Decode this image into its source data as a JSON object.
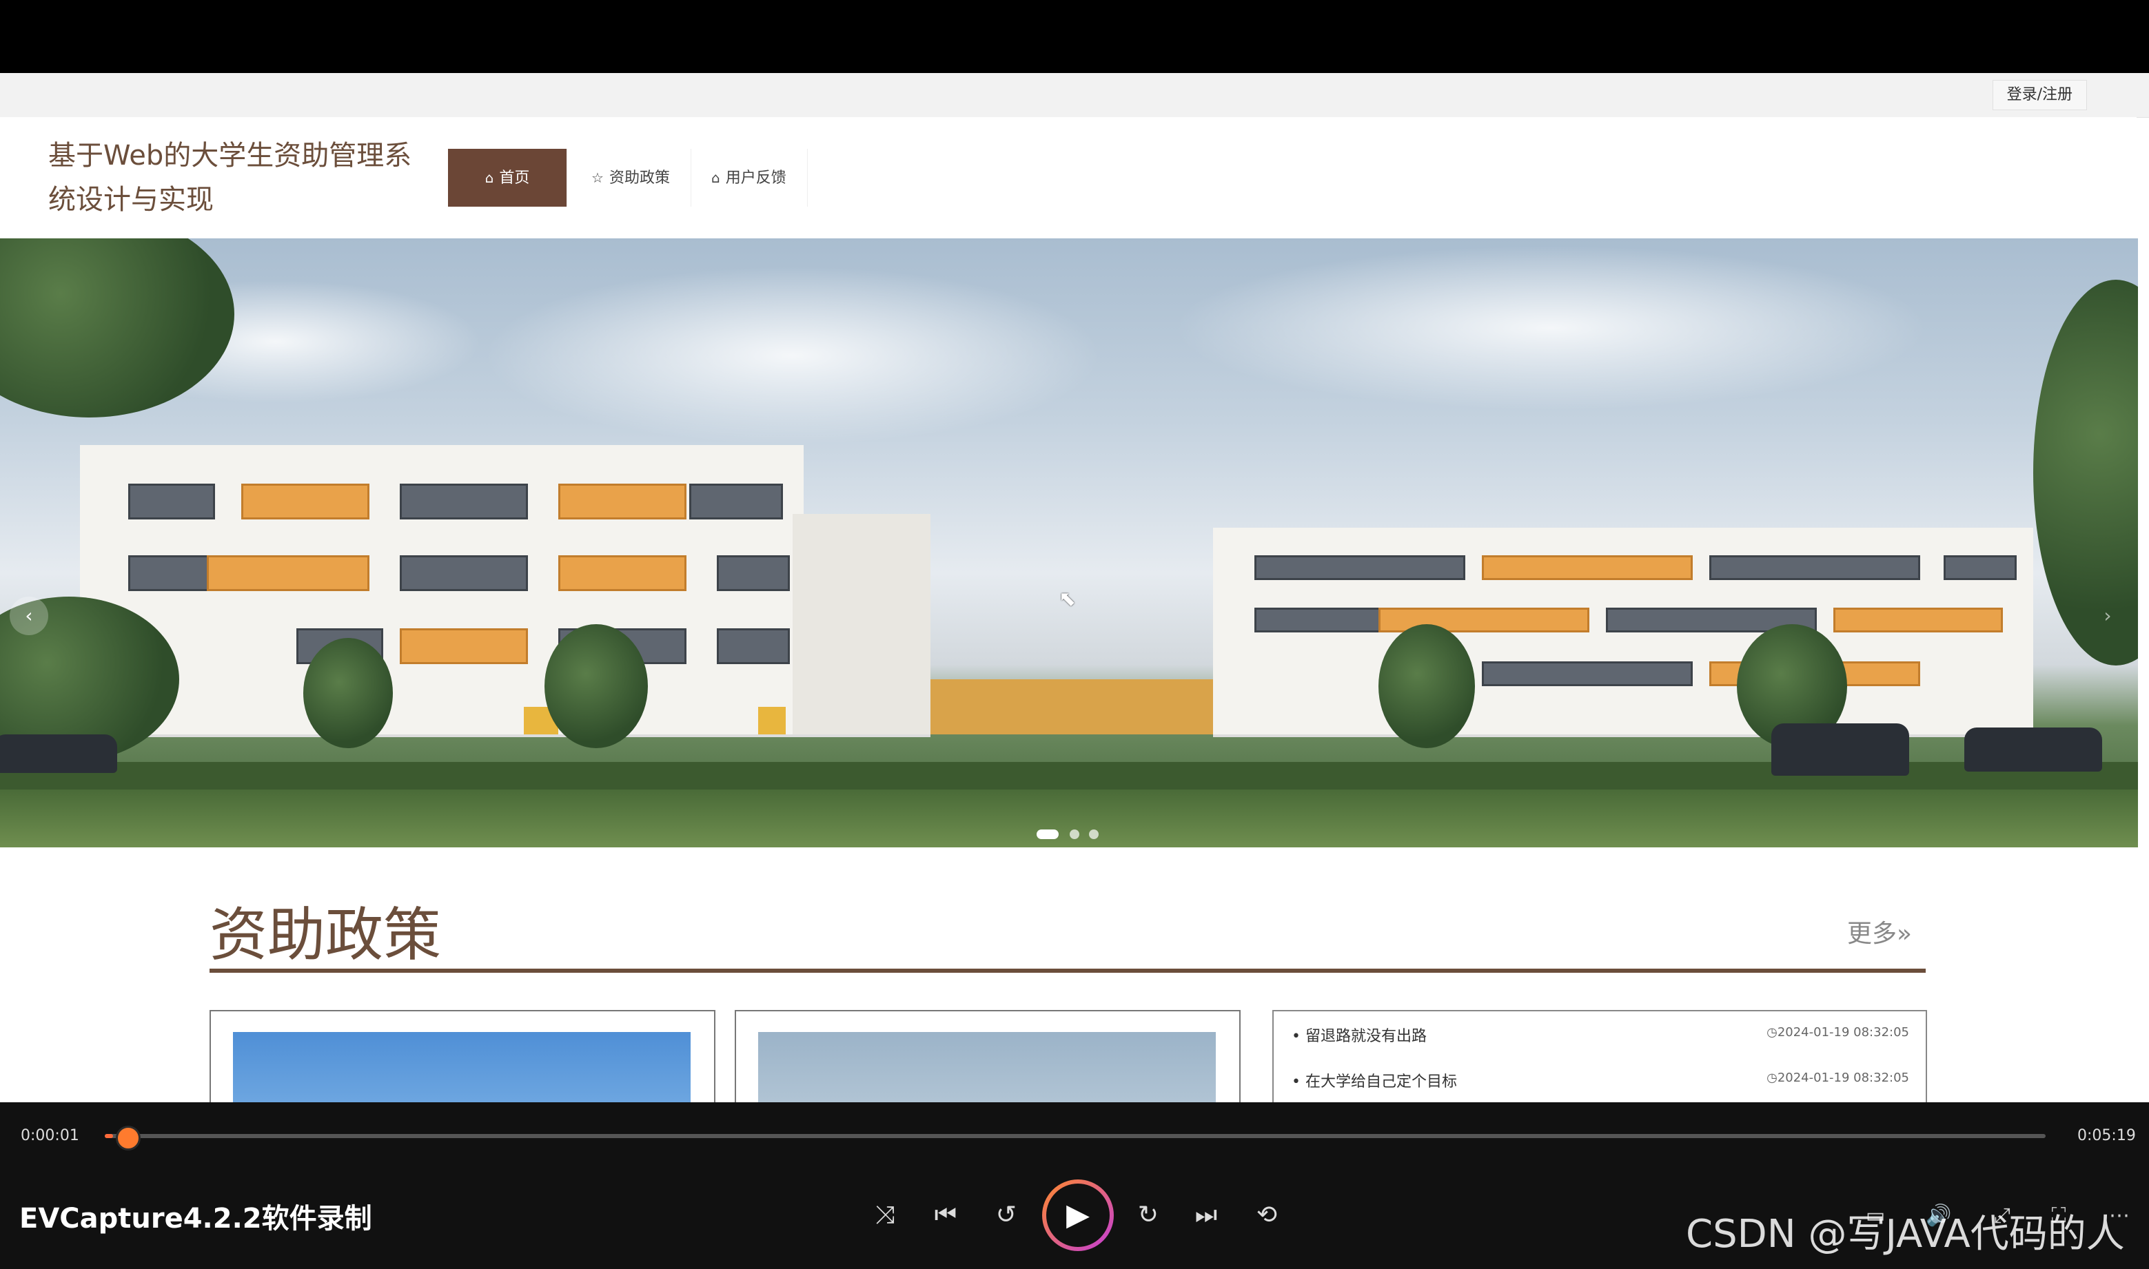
{
  "page": {
    "login_label": "登录/注册",
    "site_title": "基于Web的大学生资助管理系统设计与实现",
    "nav": [
      {
        "label": "首页",
        "icon": "home-icon",
        "active": true
      },
      {
        "label": "资助政策",
        "icon": "star-icon",
        "active": false
      },
      {
        "label": "用户反馈",
        "icon": "lock-icon",
        "active": false
      }
    ],
    "carousel": {
      "slide_count": 3,
      "active_slide": 1
    },
    "section": {
      "title": "资助政策",
      "more_label": "更多»"
    },
    "news": [
      {
        "title": "留退路就没有出路",
        "date": "2024-01-19 08:32:05"
      },
      {
        "title": "在大学给自己定个目标",
        "date": "2024-01-19 08:32:05"
      }
    ]
  },
  "player": {
    "current_time": "0:00:01",
    "total_time": "0:05:19",
    "progress_fraction": 0.003,
    "app_label": "EVCapture4.2.2软件录制",
    "watermark": "CSDN @写JAVA代码的人",
    "controls": [
      "shuffle-icon",
      "skip-back-icon",
      "rewind-icon",
      "play-icon",
      "forward-icon",
      "skip-forward-icon",
      "repeat-icon"
    ],
    "accent": "#ff7b2e"
  },
  "colors": {
    "brand_brown": "#6b4636",
    "title_brown": "#6b4e3b"
  }
}
